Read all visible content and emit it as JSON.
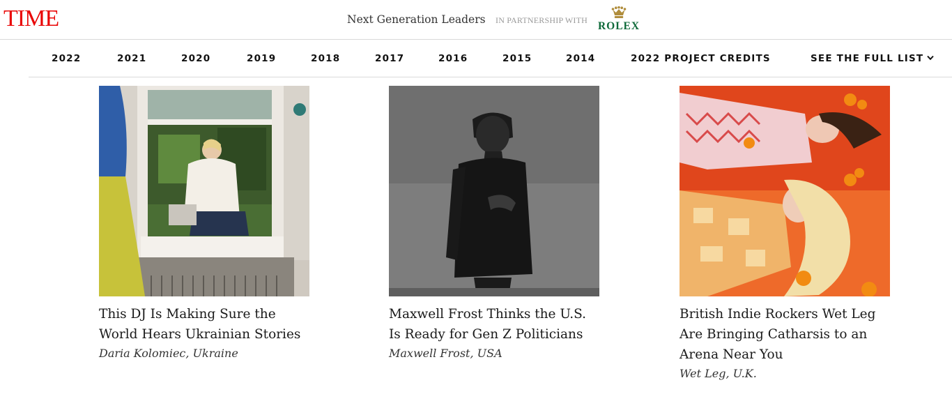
{
  "header": {
    "logo": "TIME",
    "program_title": "Next Generation Leaders",
    "partnership": "IN PARTNERSHIP WITH",
    "sponsor": "ROLEX",
    "colors": {
      "logo_red": "#e90606",
      "rolex_green": "#0f6a3a",
      "rolex_gold": "#b08d3c"
    }
  },
  "nav": {
    "items": [
      "2022",
      "2021",
      "2020",
      "2019",
      "2018",
      "2017",
      "2016",
      "2015",
      "2014",
      "2022 PROJECT CREDITS",
      "SEE THE FULL LIST"
    ],
    "dropdown_icon": "chevron-down-icon"
  },
  "cards": [
    {
      "title": "This DJ Is Making Sure the World Hears Ukrainian Stories",
      "subtitle": "Daria Kolomiec, Ukraine"
    },
    {
      "title": "Maxwell Frost Thinks the U.S. Is Ready for Gen Z Politicians",
      "subtitle": "Maxwell Frost, USA"
    },
    {
      "title": "British Indie Rockers Wet Leg Are Bringing Catharsis to an Arena Near You",
      "subtitle": "Wet Leg, U.K."
    }
  ]
}
